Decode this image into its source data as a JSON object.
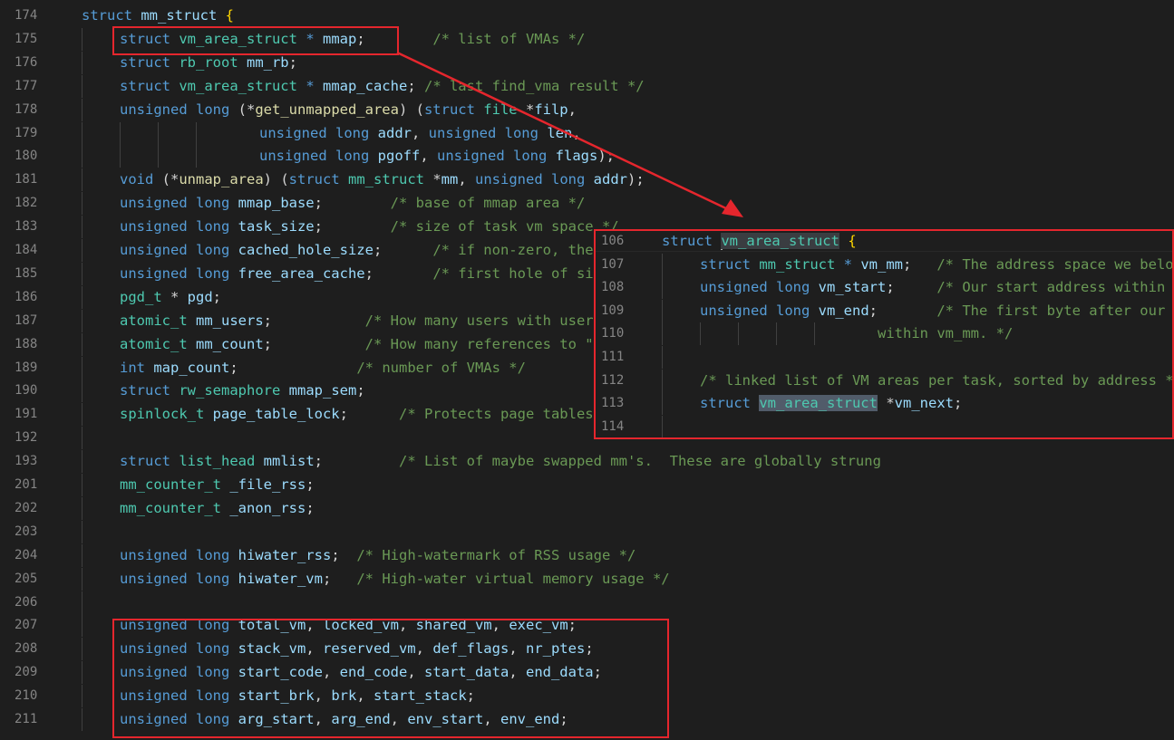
{
  "editor": {
    "language": "c",
    "theme_colors": {
      "background": "#1e1e1e",
      "keyword": "#569cd6",
      "type": "#4ec9b0",
      "identifier": "#9cdcfe",
      "comment": "#6a9955",
      "highlight_box": "#e5262d"
    },
    "lines": [
      {
        "num": "174",
        "indent": 0,
        "tokens": [
          [
            "kw",
            "struct "
          ],
          [
            "id",
            "mm_struct "
          ],
          [
            "br",
            "{"
          ]
        ]
      },
      {
        "num": "175",
        "indent": 1,
        "tokens": [
          [
            "kw",
            "struct "
          ],
          [
            "ty",
            "vm_area_struct "
          ],
          [
            "kw",
            "* "
          ],
          [
            "id",
            "mmap"
          ],
          [
            "p",
            ";"
          ],
          [
            "p",
            "        "
          ],
          [
            "cm",
            "/* list of VMAs */"
          ]
        ]
      },
      {
        "num": "176",
        "indent": 1,
        "tokens": [
          [
            "kw",
            "struct "
          ],
          [
            "ty",
            "rb_root "
          ],
          [
            "id",
            "mm_rb"
          ],
          [
            "p",
            ";"
          ]
        ]
      },
      {
        "num": "177",
        "indent": 1,
        "tokens": [
          [
            "kw",
            "struct "
          ],
          [
            "ty",
            "vm_area_struct "
          ],
          [
            "kw",
            "* "
          ],
          [
            "id",
            "mmap_cache"
          ],
          [
            "p",
            "; "
          ],
          [
            "cm",
            "/* last find_vma result */"
          ]
        ]
      },
      {
        "num": "178",
        "indent": 1,
        "tokens": [
          [
            "kw",
            "unsigned long "
          ],
          [
            "p",
            "(*"
          ],
          [
            "fn",
            "get_unmapped_area"
          ],
          [
            "p",
            ") ("
          ],
          [
            "kw",
            "struct "
          ],
          [
            "ty",
            "file "
          ],
          [
            "p",
            "*"
          ],
          [
            "id",
            "filp"
          ],
          [
            "p",
            ","
          ]
        ]
      },
      {
        "num": "179",
        "indent": 4,
        "tokens": [
          [
            "p",
            "   "
          ],
          [
            "kw",
            "unsigned long "
          ],
          [
            "id",
            "addr"
          ],
          [
            "p",
            ", "
          ],
          [
            "kw",
            "unsigned long "
          ],
          [
            "id",
            "len"
          ],
          [
            "p",
            ","
          ]
        ]
      },
      {
        "num": "180",
        "indent": 4,
        "tokens": [
          [
            "p",
            "   "
          ],
          [
            "kw",
            "unsigned long "
          ],
          [
            "id",
            "pgoff"
          ],
          [
            "p",
            ", "
          ],
          [
            "kw",
            "unsigned long "
          ],
          [
            "id",
            "flags"
          ],
          [
            "p",
            ");"
          ]
        ]
      },
      {
        "num": "181",
        "indent": 1,
        "tokens": [
          [
            "kw",
            "void "
          ],
          [
            "p",
            "(*"
          ],
          [
            "fn",
            "unmap_area"
          ],
          [
            "p",
            ") ("
          ],
          [
            "kw",
            "struct "
          ],
          [
            "ty",
            "mm_struct "
          ],
          [
            "p",
            "*"
          ],
          [
            "id",
            "mm"
          ],
          [
            "p",
            ", "
          ],
          [
            "kw",
            "unsigned long "
          ],
          [
            "id",
            "addr"
          ],
          [
            "p",
            ");"
          ]
        ]
      },
      {
        "num": "182",
        "indent": 1,
        "tokens": [
          [
            "kw",
            "unsigned long "
          ],
          [
            "id",
            "mmap_base"
          ],
          [
            "p",
            ";"
          ],
          [
            "p",
            "        "
          ],
          [
            "cm",
            "/* base of mmap area */"
          ]
        ]
      },
      {
        "num": "183",
        "indent": 1,
        "tokens": [
          [
            "kw",
            "unsigned long "
          ],
          [
            "id",
            "task_size"
          ],
          [
            "p",
            ";"
          ],
          [
            "p",
            "        "
          ],
          [
            "cm",
            "/* size of task vm space */"
          ]
        ]
      },
      {
        "num": "184",
        "indent": 1,
        "tokens": [
          [
            "kw",
            "unsigned long "
          ],
          [
            "id",
            "cached_hole_size"
          ],
          [
            "p",
            ";"
          ],
          [
            "p",
            "      "
          ],
          [
            "cm",
            "/* if non-zero, the largest hole below free_area_cache */"
          ]
        ]
      },
      {
        "num": "185",
        "indent": 1,
        "tokens": [
          [
            "kw",
            "unsigned long "
          ],
          [
            "id",
            "free_area_cache"
          ],
          [
            "p",
            ";"
          ],
          [
            "p",
            "       "
          ],
          [
            "cm",
            "/* first hole of size cached_hole_size or larger */"
          ]
        ]
      },
      {
        "num": "186",
        "indent": 1,
        "tokens": [
          [
            "ty",
            "pgd_t "
          ],
          [
            "p",
            "* "
          ],
          [
            "id",
            "pgd"
          ],
          [
            "p",
            ";"
          ]
        ]
      },
      {
        "num": "187",
        "indent": 1,
        "tokens": [
          [
            "ty",
            "atomic_t "
          ],
          [
            "id",
            "mm_users"
          ],
          [
            "p",
            ";"
          ],
          [
            "p",
            "           "
          ],
          [
            "cm",
            "/* How many users with user space? */"
          ]
        ]
      },
      {
        "num": "188",
        "indent": 1,
        "tokens": [
          [
            "ty",
            "atomic_t "
          ],
          [
            "id",
            "mm_count"
          ],
          [
            "p",
            ";"
          ],
          [
            "p",
            "           "
          ],
          [
            "cm",
            "/* How many references to \"struct mm_struct\" */"
          ]
        ]
      },
      {
        "num": "189",
        "indent": 1,
        "tokens": [
          [
            "kw",
            "int "
          ],
          [
            "id",
            "map_count"
          ],
          [
            "p",
            ";"
          ],
          [
            "p",
            "              "
          ],
          [
            "cm",
            "/* number of VMAs */"
          ]
        ]
      },
      {
        "num": "190",
        "indent": 1,
        "tokens": [
          [
            "kw",
            "struct "
          ],
          [
            "ty",
            "rw_semaphore "
          ],
          [
            "id",
            "mmap_sem"
          ],
          [
            "p",
            ";"
          ]
        ]
      },
      {
        "num": "191",
        "indent": 1,
        "tokens": [
          [
            "ty",
            "spinlock_t "
          ],
          [
            "id",
            "page_table_lock"
          ],
          [
            "p",
            ";"
          ],
          [
            "p",
            "      "
          ],
          [
            "cm",
            "/* Protects page tables and some counters */"
          ]
        ]
      },
      {
        "num": "192",
        "indent": 1,
        "tokens": []
      },
      {
        "num": "193",
        "indent": 1,
        "tokens": [
          [
            "kw",
            "struct "
          ],
          [
            "ty",
            "list_head "
          ],
          [
            "id",
            "mmlist"
          ],
          [
            "p",
            ";"
          ],
          [
            "p",
            "         "
          ],
          [
            "cm",
            "/* List of maybe swapped mm's.  These are globally strung"
          ]
        ]
      },
      {
        "num": "201",
        "indent": 1,
        "tokens": [
          [
            "ty",
            "mm_counter_t "
          ],
          [
            "id",
            "_file_rss"
          ],
          [
            "p",
            ";"
          ]
        ]
      },
      {
        "num": "202",
        "indent": 1,
        "tokens": [
          [
            "ty",
            "mm_counter_t "
          ],
          [
            "id",
            "_anon_rss"
          ],
          [
            "p",
            ";"
          ]
        ]
      },
      {
        "num": "203",
        "indent": 1,
        "tokens": []
      },
      {
        "num": "204",
        "indent": 1,
        "tokens": [
          [
            "kw",
            "unsigned long "
          ],
          [
            "id",
            "hiwater_rss"
          ],
          [
            "p",
            ";"
          ],
          [
            "p",
            "  "
          ],
          [
            "cm",
            "/* High-watermark of RSS usage */"
          ]
        ]
      },
      {
        "num": "205",
        "indent": 1,
        "tokens": [
          [
            "kw",
            "unsigned long "
          ],
          [
            "id",
            "hiwater_vm"
          ],
          [
            "p",
            ";"
          ],
          [
            "p",
            "   "
          ],
          [
            "cm",
            "/* High-water virtual memory usage */"
          ]
        ]
      },
      {
        "num": "206",
        "indent": 1,
        "tokens": []
      },
      {
        "num": "207",
        "indent": 1,
        "tokens": [
          [
            "kw",
            "unsigned long "
          ],
          [
            "id",
            "total_vm"
          ],
          [
            "p",
            ", "
          ],
          [
            "id",
            "locked_vm"
          ],
          [
            "p",
            ", "
          ],
          [
            "id",
            "shared_vm"
          ],
          [
            "p",
            ", "
          ],
          [
            "id",
            "exec_vm"
          ],
          [
            "p",
            ";"
          ]
        ]
      },
      {
        "num": "208",
        "indent": 1,
        "tokens": [
          [
            "kw",
            "unsigned long "
          ],
          [
            "id",
            "stack_vm"
          ],
          [
            "p",
            ", "
          ],
          [
            "id",
            "reserved_vm"
          ],
          [
            "p",
            ", "
          ],
          [
            "id",
            "def_flags"
          ],
          [
            "p",
            ", "
          ],
          [
            "id",
            "nr_ptes"
          ],
          [
            "p",
            ";"
          ]
        ]
      },
      {
        "num": "209",
        "indent": 1,
        "tokens": [
          [
            "kw",
            "unsigned long "
          ],
          [
            "id",
            "start_code"
          ],
          [
            "p",
            ", "
          ],
          [
            "id",
            "end_code"
          ],
          [
            "p",
            ", "
          ],
          [
            "id",
            "start_data"
          ],
          [
            "p",
            ", "
          ],
          [
            "id",
            "end_data"
          ],
          [
            "p",
            ";"
          ]
        ]
      },
      {
        "num": "210",
        "indent": 1,
        "tokens": [
          [
            "kw",
            "unsigned long "
          ],
          [
            "id",
            "start_brk"
          ],
          [
            "p",
            ", "
          ],
          [
            "id",
            "brk"
          ],
          [
            "p",
            ", "
          ],
          [
            "id",
            "start_stack"
          ],
          [
            "p",
            ";"
          ]
        ]
      },
      {
        "num": "211",
        "indent": 1,
        "tokens": [
          [
            "kw",
            "unsigned long "
          ],
          [
            "id",
            "arg_start"
          ],
          [
            "p",
            ", "
          ],
          [
            "id",
            "arg_end"
          ],
          [
            "p",
            ", "
          ],
          [
            "id",
            "env_start"
          ],
          [
            "p",
            ", "
          ],
          [
            "id",
            "env_end"
          ],
          [
            "p",
            ";"
          ]
        ]
      }
    ]
  },
  "peek": {
    "lines": [
      {
        "num": "106",
        "indent": 0,
        "tokens": [
          [
            "kw",
            "struct "
          ],
          [
            "cur",
            ""
          ],
          [
            "hl",
            "vm_area_struct"
          ],
          [
            "p",
            " "
          ],
          [
            "br",
            "{"
          ]
        ]
      },
      {
        "num": "107",
        "indent": 1,
        "tokens": [
          [
            "kw",
            "struct "
          ],
          [
            "ty",
            "mm_struct "
          ],
          [
            "kw",
            "* "
          ],
          [
            "id",
            "vm_mm"
          ],
          [
            "p",
            ";"
          ],
          [
            "p",
            "   "
          ],
          [
            "cm",
            "/* The address space we belong to. */"
          ]
        ]
      },
      {
        "num": "108",
        "indent": 1,
        "tokens": [
          [
            "kw",
            "unsigned long "
          ],
          [
            "id",
            "vm_start"
          ],
          [
            "p",
            ";"
          ],
          [
            "p",
            "     "
          ],
          [
            "cm",
            "/* Our start address within vm_mm. */"
          ]
        ]
      },
      {
        "num": "109",
        "indent": 1,
        "tokens": [
          [
            "kw",
            "unsigned long "
          ],
          [
            "id",
            "vm_end"
          ],
          [
            "p",
            ";"
          ],
          [
            "p",
            "       "
          ],
          [
            "cm",
            "/* The first byte after our end address"
          ]
        ]
      },
      {
        "num": "110",
        "indent": 5,
        "tokens": [
          [
            "cm",
            "   within vm_mm. */"
          ]
        ]
      },
      {
        "num": "111",
        "indent": 1,
        "tokens": []
      },
      {
        "num": "112",
        "indent": 1,
        "tokens": [
          [
            "cm",
            "/* linked list of VM areas per task, sorted by address */"
          ]
        ]
      },
      {
        "num": "113",
        "indent": 1,
        "tokens": [
          [
            "kw",
            "struct "
          ],
          [
            "ref",
            "vm_area_struct"
          ],
          [
            "p",
            " *"
          ],
          [
            "id",
            "vm_next"
          ],
          [
            "p",
            ";"
          ]
        ]
      },
      {
        "num": "114",
        "indent": 1,
        "tokens": []
      }
    ]
  }
}
